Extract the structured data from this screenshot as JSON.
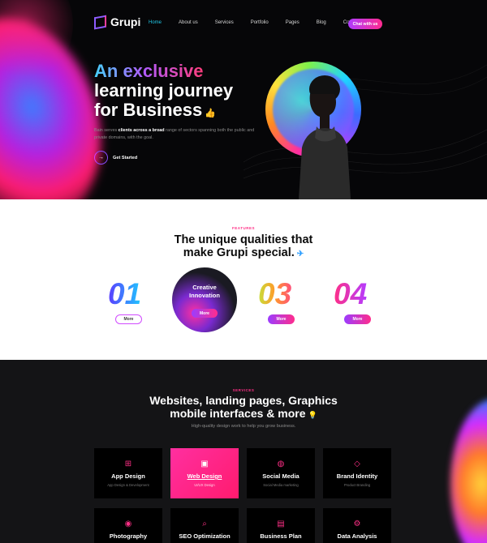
{
  "nav": {
    "brand": "Grupi",
    "links": [
      "Home",
      "About us",
      "Services",
      "Portfolio",
      "Pages",
      "Blog",
      "Contact us"
    ],
    "cta": "Chat with us"
  },
  "hero": {
    "title_highlight": "An exclusive",
    "title_line2": "learning journey",
    "title_line3": "for Business",
    "desc_pre": "Bain serves ",
    "desc_bold": "clients across a broad",
    "desc_post": " range of sectors spanning both the public and private domains, with the goal.",
    "button_label": "Get Started"
  },
  "features": {
    "eyebrow": "FEATURES",
    "title_line1": "The unique qualities that",
    "title_line2": "make Grupi special.",
    "items": [
      {
        "number": "01",
        "button": "More"
      },
      {
        "label_line1": "Creative",
        "label_line2": "Innovation",
        "button": "More"
      },
      {
        "number": "03",
        "button": "More"
      },
      {
        "number": "04",
        "button": "More"
      }
    ]
  },
  "services": {
    "eyebrow": "SERVICES",
    "title_line1": "Websites, landing pages, Graphics",
    "title_line2": "mobile interfaces & more",
    "subtitle": "High-quality design work to help you grow business.",
    "cards": [
      {
        "icon": "grid-icon",
        "title": "App Design",
        "sub": "App Design & Development"
      },
      {
        "icon": "image-icon",
        "title": "Web Design",
        "sub": "UI/UX Design"
      },
      {
        "icon": "globe-icon",
        "title": "Social Media",
        "sub": "Social Media marketing"
      },
      {
        "icon": "diamond-icon",
        "title": "Brand Identity",
        "sub": "Product Branding"
      },
      {
        "icon": "camera-icon",
        "title": "Photography",
        "sub": ""
      },
      {
        "icon": "search-icon",
        "title": "SEO Optimization",
        "sub": ""
      },
      {
        "icon": "document-icon",
        "title": "Business Plan",
        "sub": ""
      },
      {
        "icon": "gear-icon",
        "title": "Data Analysis",
        "sub": ""
      }
    ]
  },
  "colors": {
    "accent_pink": "#ff2f86",
    "accent_cyan": "#20c7e6",
    "accent_purple": "#9b3cff"
  }
}
